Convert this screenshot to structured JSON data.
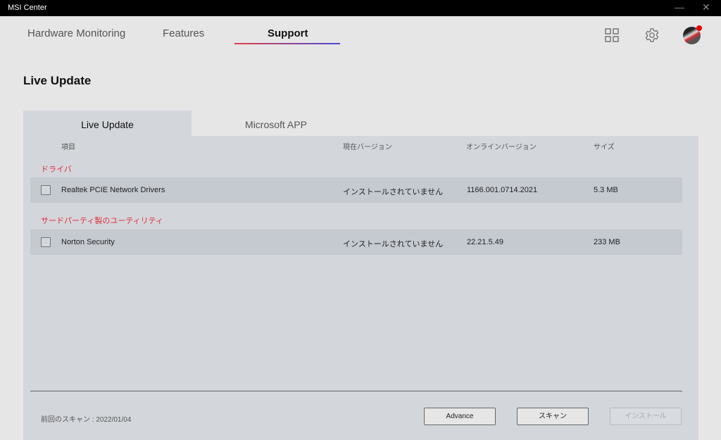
{
  "window": {
    "title": "MSI Center"
  },
  "nav": {
    "items": [
      "Hardware Monitoring",
      "Features",
      "Support"
    ],
    "active": "Support"
  },
  "page_title": "Live Update",
  "tabs": [
    "Live Update",
    "Microsoft APP"
  ],
  "columns": [
    "項目",
    "現在バージョン",
    "オンラインバージョン",
    "サイズ"
  ],
  "categories": [
    {
      "label": "ドライバ",
      "items": [
        {
          "name": "Realtek PCIE Network Drivers",
          "current": "インストールされていません",
          "online": "1166.001.0714.2021",
          "size": "5.3 MB",
          "checked": false
        }
      ]
    },
    {
      "label": "サードパーティ製のユーティリティ",
      "items": [
        {
          "name": "Norton Security",
          "current": "インストールされていません",
          "online": "22.21.5.49",
          "size": "233 MB",
          "checked": false
        }
      ]
    }
  ],
  "footer": {
    "last_scan": "前回のスキャン : 2022/01/04",
    "advance": "Advance",
    "scan": "スキャン",
    "install": "インストール"
  },
  "colors": {
    "accent_red": "#e0303a",
    "accent_blue": "#4a4ad0"
  }
}
